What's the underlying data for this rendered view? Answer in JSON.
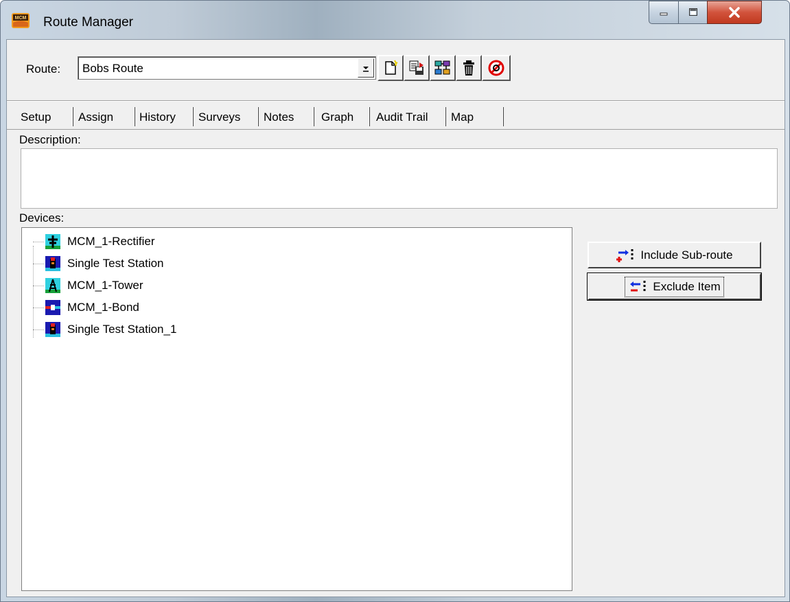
{
  "window": {
    "title": "Route Manager",
    "icons": {
      "app": "mcm-app-icon",
      "minimize": "minimize-icon",
      "maximize": "maximize-icon",
      "close": "close-icon"
    },
    "colors": {
      "close_button": "#c7432b",
      "client_bg": "#f0f0f0"
    }
  },
  "route": {
    "label": "Route:",
    "selected": "Bobs Route",
    "toolbar_icons": [
      "new-route-icon",
      "save-copy-route-icon",
      "route-properties-icon",
      "delete-route-icon",
      "cancel-icon"
    ]
  },
  "tabs": [
    {
      "label": "Setup",
      "active": true
    },
    {
      "label": "Assign"
    },
    {
      "label": "History"
    },
    {
      "label": "Surveys"
    },
    {
      "label": "Notes"
    },
    {
      "label": "Graph"
    },
    {
      "label": "Audit Trail"
    },
    {
      "label": "Map"
    }
  ],
  "setup": {
    "description_label": "Description:",
    "description_value": "",
    "devices_label": "Devices:",
    "devices": [
      {
        "label": "MCM_1-Rectifier",
        "icon": "rectifier-icon"
      },
      {
        "label": "Single Test Station",
        "icon": "test-station-icon"
      },
      {
        "label": "MCM_1-Tower",
        "icon": "tower-icon"
      },
      {
        "label": "MCM_1-Bond",
        "icon": "bond-icon"
      },
      {
        "label": "Single Test Station_1",
        "icon": "test-station-icon"
      }
    ],
    "include_button": "Include Sub-route",
    "exclude_button": "Exclude Item"
  }
}
